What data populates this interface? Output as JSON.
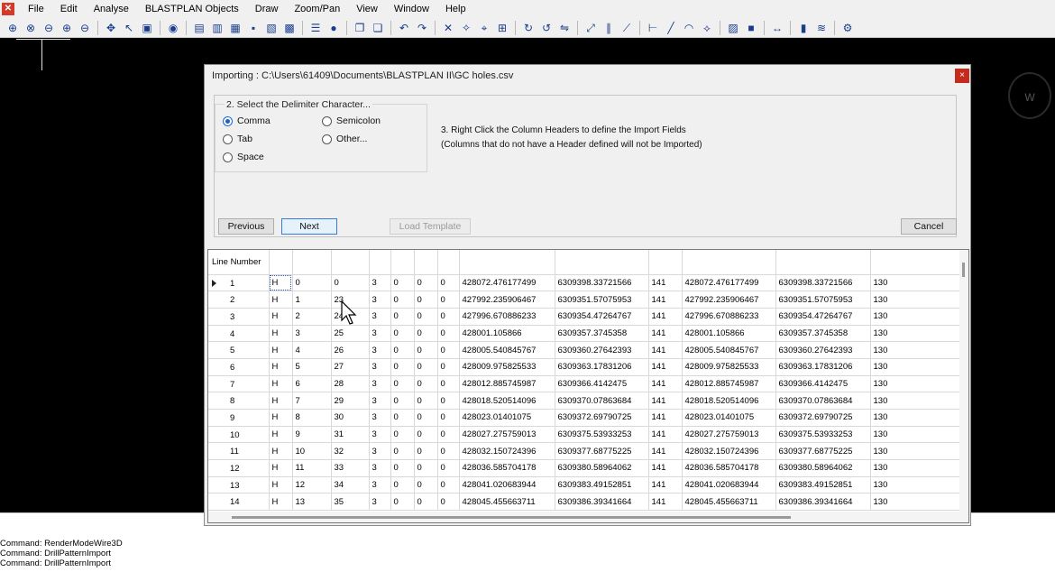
{
  "menubar": {
    "items": [
      "File",
      "Edit",
      "Analyse",
      "BLASTPLAN Objects",
      "Draw",
      "Zoom/Pan",
      "View",
      "Window",
      "Help"
    ]
  },
  "toolbar": {
    "icons": [
      "zoom-extents-icon",
      "zoom-window-icon",
      "zoom-previous-icon",
      "zoom-in-icon",
      "zoom-out-icon",
      "sep",
      "pan-icon",
      "select-icon",
      "box-icon",
      "sep",
      "render-icon",
      "sep",
      "new-icon",
      "open-icon",
      "import-icon",
      "save-icon",
      "export-icon",
      "print-icon",
      "sep",
      "layers-icon",
      "globe-icon",
      "sep",
      "copy-icon",
      "paste-icon",
      "sep",
      "undo-icon",
      "redo-icon",
      "sep",
      "delete-icon",
      "move-icon",
      "snap-icon",
      "join-icon",
      "sep",
      "rotate-icon",
      "rotate-ccw-icon",
      "mirror-icon",
      "sep",
      "scale-icon",
      "offset-icon",
      "trim-icon",
      "sep",
      "measure-icon",
      "line-icon",
      "arc-icon",
      "polyline-icon",
      "sep",
      "hatch-icon",
      "fill-icon",
      "sep",
      "dimension-icon",
      "sep",
      "chart-icon",
      "profile-icon",
      "sep",
      "settings-icon"
    ]
  },
  "viewcube": {
    "label": "W"
  },
  "command_lines": [
    "Command: RenderModeWire3D",
    "Command: DrillPatternImport",
    "Command: DrillPatternImport"
  ],
  "dialog": {
    "title": "Importing : C:\\Users\\61409\\Documents\\BLASTPLAN II\\GC holes.csv",
    "close_label": "×",
    "delimiter_group": "2. Select the Delimiter Character...",
    "delimiters": [
      {
        "label": "Comma",
        "checked": true
      },
      {
        "label": "Semicolon",
        "checked": false
      },
      {
        "label": "Tab",
        "checked": false
      },
      {
        "label": "Other...",
        "checked": false
      },
      {
        "label": "Space",
        "checked": false
      }
    ],
    "instruction_1": "3. Right Click the Column Headers to define the Import Fields",
    "instruction_2": "(Columns that do not have a Header defined will not be Imported)",
    "buttons": {
      "previous": "Previous",
      "next": "Next",
      "load_template": "Load Template",
      "cancel": "Cancel"
    },
    "grid": {
      "row_header_label": "Line Number",
      "rows": [
        [
          "1",
          "H",
          "0",
          "0",
          "3",
          "0",
          "0",
          "0",
          "428072.476177499",
          "6309398.33721566",
          "141",
          "428072.476177499",
          "6309398.33721566",
          "130"
        ],
        [
          "2",
          "H",
          "1",
          "23",
          "3",
          "0",
          "0",
          "0",
          "427992.235906467",
          "6309351.57075953",
          "141",
          "427992.235906467",
          "6309351.57075953",
          "130"
        ],
        [
          "3",
          "H",
          "2",
          "24",
          "3",
          "0",
          "0",
          "0",
          "427996.670886233",
          "6309354.47264767",
          "141",
          "427996.670886233",
          "6309354.47264767",
          "130"
        ],
        [
          "4",
          "H",
          "3",
          "25",
          "3",
          "0",
          "0",
          "0",
          "428001.105866",
          "6309357.3745358",
          "141",
          "428001.105866",
          "6309357.3745358",
          "130"
        ],
        [
          "5",
          "H",
          "4",
          "26",
          "3",
          "0",
          "0",
          "0",
          "428005.540845767",
          "6309360.27642393",
          "141",
          "428005.540845767",
          "6309360.27642393",
          "130"
        ],
        [
          "6",
          "H",
          "5",
          "27",
          "3",
          "0",
          "0",
          "0",
          "428009.975825533",
          "6309363.17831206",
          "141",
          "428009.975825533",
          "6309363.17831206",
          "130"
        ],
        [
          "7",
          "H",
          "6",
          "28",
          "3",
          "0",
          "0",
          "0",
          "428012.885745987",
          "6309366.4142475",
          "141",
          "428012.885745987",
          "6309366.4142475",
          "130"
        ],
        [
          "8",
          "H",
          "7",
          "29",
          "3",
          "0",
          "0",
          "0",
          "428018.520514096",
          "6309370.07863684",
          "141",
          "428018.520514096",
          "6309370.07863684",
          "130"
        ],
        [
          "9",
          "H",
          "8",
          "30",
          "3",
          "0",
          "0",
          "0",
          "428023.01401075",
          "6309372.69790725",
          "141",
          "428023.01401075",
          "6309372.69790725",
          "130"
        ],
        [
          "10",
          "H",
          "9",
          "31",
          "3",
          "0",
          "0",
          "0",
          "428027.275759013",
          "6309375.53933253",
          "141",
          "428027.275759013",
          "6309375.53933253",
          "130"
        ],
        [
          "11",
          "H",
          "10",
          "32",
          "3",
          "0",
          "0",
          "0",
          "428032.150724396",
          "6309377.68775225",
          "141",
          "428032.150724396",
          "6309377.68775225",
          "130"
        ],
        [
          "12",
          "H",
          "11",
          "33",
          "3",
          "0",
          "0",
          "0",
          "428036.585704178",
          "6309380.58964062",
          "141",
          "428036.585704178",
          "6309380.58964062",
          "130"
        ],
        [
          "13",
          "H",
          "12",
          "34",
          "3",
          "0",
          "0",
          "0",
          "428041.020683944",
          "6309383.49152851",
          "141",
          "428041.020683944",
          "6309383.49152851",
          "130"
        ],
        [
          "14",
          "H",
          "13",
          "35",
          "3",
          "0",
          "0",
          "0",
          "428045.455663711",
          "6309386.39341664",
          "141",
          "428045.455663711",
          "6309386.39341664",
          "130"
        ]
      ]
    }
  }
}
